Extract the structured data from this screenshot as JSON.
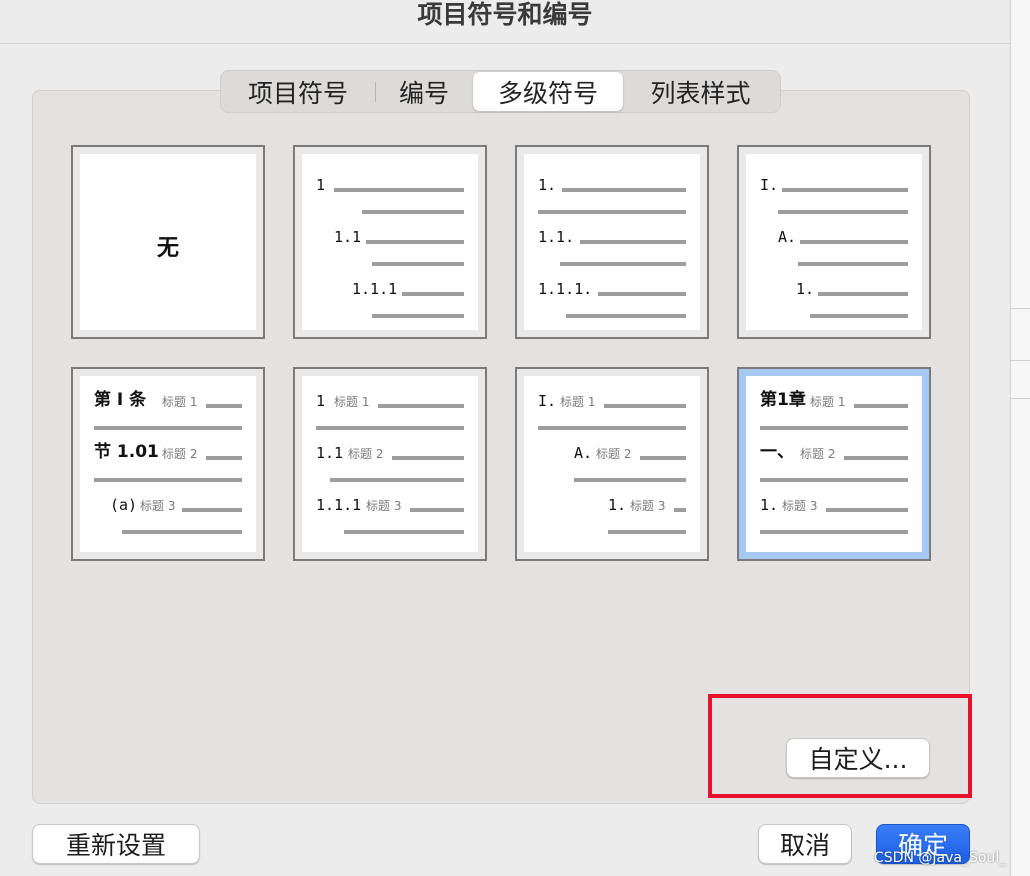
{
  "dialog": {
    "title": "项目符号和编号"
  },
  "tabs": [
    {
      "label": "项目符号",
      "active": false
    },
    {
      "label": "编号",
      "active": false
    },
    {
      "label": "多级符号",
      "active": true
    },
    {
      "label": "列表样式",
      "active": false
    }
  ],
  "presets": {
    "none_label": "无",
    "p2": {
      "l1": "1",
      "l2": "1.1",
      "l3": "1.1.1"
    },
    "p3": {
      "l1": "1.",
      "l2": "1.1.",
      "l3": "1.1.1."
    },
    "p4": {
      "l1": "I.",
      "l2": "A.",
      "l3": "1."
    },
    "p5": {
      "l1": "第 I 条",
      "l2": "节 1.01",
      "l3": "(a)",
      "h1": "标题 1",
      "h2": "标题 2",
      "h3": "标题 3"
    },
    "p6": {
      "l1": "1",
      "l2": "1.1",
      "l3": "1.1.1",
      "h1": "标题 1",
      "h2": "标题 2",
      "h3": "标题 3"
    },
    "p7": {
      "l1": "I.",
      "l2": "A.",
      "l3": "1.",
      "h1": "标题 1",
      "h2": "标题 2",
      "h3": "标题 3"
    },
    "p8": {
      "l1": "第1章",
      "l2": "一、",
      "l3": "1.",
      "h1": "标题 1",
      "h2": "标题 2",
      "h3": "标题 3"
    }
  },
  "buttons": {
    "customize": "自定义...",
    "reset": "重新设置",
    "cancel": "取消",
    "ok": "确定"
  },
  "watermark": "CSDN @Java_Soul_",
  "colors": {
    "selected_border": "#a6c8f5",
    "annotation_red": "#e8112d",
    "primary_blue": "#1b5fe3"
  }
}
